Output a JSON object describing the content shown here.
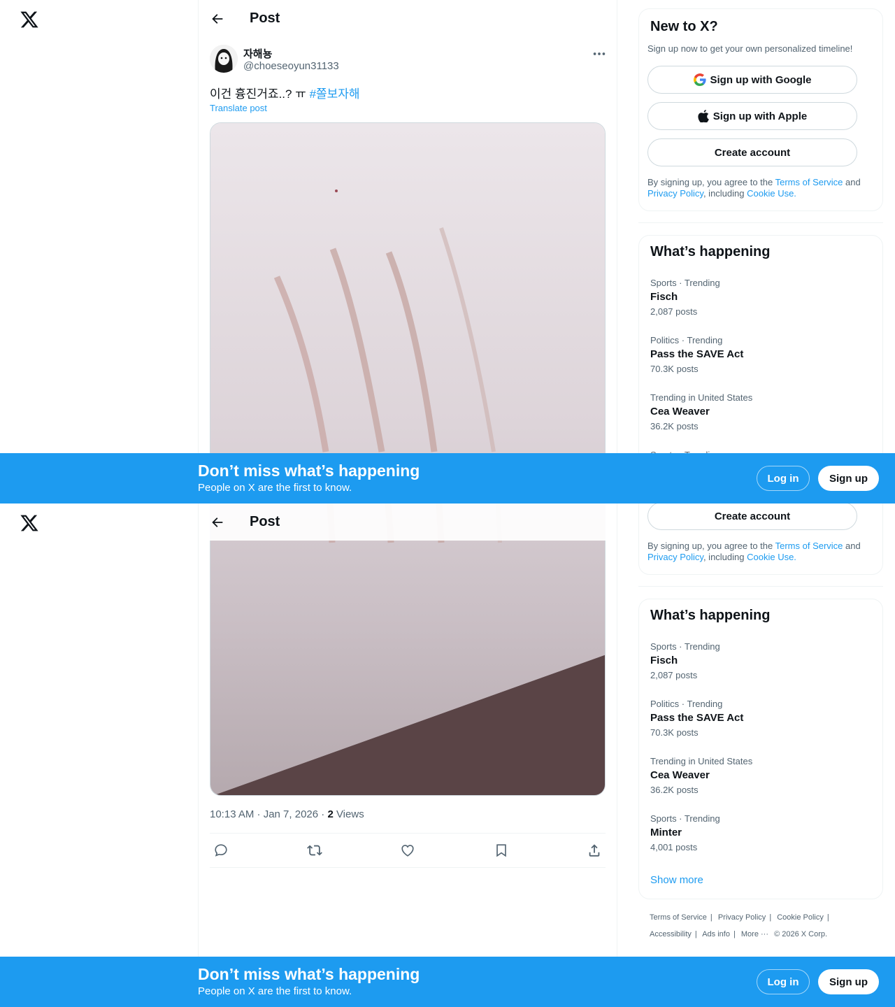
{
  "header": {
    "title": "Post"
  },
  "post": {
    "display_name": "자해뇽",
    "handle": "@choeseoyun31133",
    "text": "이건 흉진거죠..? ㅠ",
    "hashtag": "#쫄보자해",
    "translate_label": "Translate post",
    "time": "10:13 AM · Jan 7, 2026 · ",
    "views_count": "2",
    "views_label": " Views"
  },
  "actions": [
    "reply-icon",
    "repost-icon",
    "like-icon",
    "bookmark-icon",
    "share-icon"
  ],
  "signup_card": {
    "title": "New to X?",
    "subtitle": "Sign up now to get your own personalized timeline!",
    "google_label": "Sign up with Google",
    "apple_label": "Sign up with Apple",
    "create_label": "Create account",
    "legal_pre": "By signing up, you agree to the ",
    "terms": "Terms of Service",
    "and": " and",
    "privacy": "Privacy Policy",
    "including": ", including ",
    "cookie": "Cookie Use."
  },
  "trends": {
    "title": "What’s happening",
    "items": [
      {
        "category": "Sports · Trending",
        "name": "Fisch",
        "count": "2,087 posts"
      },
      {
        "category": "Politics · Trending",
        "name": "Pass the SAVE Act",
        "count": "70.3K posts"
      },
      {
        "category": "Trending in United States",
        "name": "Cea Weaver",
        "count": "36.2K posts"
      },
      {
        "category": "Sports · Trending",
        "name": "Minter",
        "count": "4,001 posts"
      }
    ],
    "show_more": "Show more"
  },
  "footer": {
    "terms": "Terms of Service",
    "privacy": "Privacy Policy",
    "cookie": "Cookie Policy",
    "accessibility": "Accessibility",
    "ads": "Ads info",
    "more": "More ···",
    "copyright": "© 2026 X Corp."
  },
  "banner": {
    "title": "Don’t miss what’s happening",
    "subtitle": "People on X are the first to know.",
    "login": "Log in",
    "signup": "Sign up"
  },
  "colors": {
    "accent": "#1d9bf0",
    "text": "#0f1419",
    "muted": "#536471",
    "border": "#eff3f4"
  }
}
